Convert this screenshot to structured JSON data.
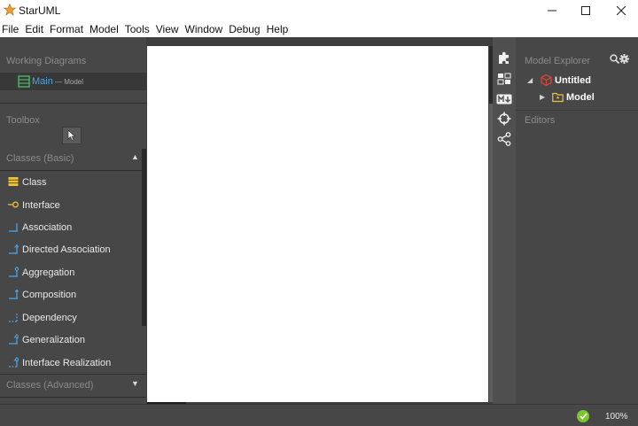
{
  "window": {
    "title": "StarUML"
  },
  "menu": [
    "File",
    "Edit",
    "Format",
    "Model",
    "Tools",
    "View",
    "Window",
    "Debug",
    "Help"
  ],
  "working_diagrams": {
    "title": "Working Diagrams",
    "items": [
      {
        "name": "Main",
        "sub": "— Model",
        "icon": "class-diagram-icon"
      }
    ]
  },
  "toolbox": {
    "title": "Toolbox",
    "pointer_icon": "pointer-icon",
    "groups": [
      {
        "label": "Classes (Basic)",
        "expanded": true,
        "items": [
          {
            "label": "Class",
            "icon": "class-icon"
          },
          {
            "label": "Interface",
            "icon": "interface-icon"
          },
          {
            "label": "Association",
            "icon": "association-icon"
          },
          {
            "label": "Directed Association",
            "icon": "directed-association-icon"
          },
          {
            "label": "Aggregation",
            "icon": "aggregation-icon"
          },
          {
            "label": "Composition",
            "icon": "composition-icon"
          },
          {
            "label": "Dependency",
            "icon": "dependency-icon"
          },
          {
            "label": "Generalization",
            "icon": "generalization-icon"
          },
          {
            "label": "Interface Realization",
            "icon": "interface-realization-icon"
          }
        ]
      },
      {
        "label": "Classes (Advanced)",
        "expanded": false
      }
    ]
  },
  "model_explorer": {
    "title": "Model Explorer",
    "tree": [
      {
        "label": "Untitled",
        "icon": "project-icon",
        "expanded": true,
        "level": 0
      },
      {
        "label": "Model",
        "icon": "model-package-icon",
        "expanded": false,
        "level": 1
      }
    ]
  },
  "editors": {
    "title": "Editors"
  },
  "status": {
    "zoom": "100%",
    "status_icon": "check-circle-icon"
  },
  "colors": {
    "panel_bg": "#474747",
    "canvas_bg": "#ffffff",
    "link_blue": "#4aa3e6",
    "status_green": "#7cc52e",
    "tool_icon_yellow": "#e8c23a"
  }
}
